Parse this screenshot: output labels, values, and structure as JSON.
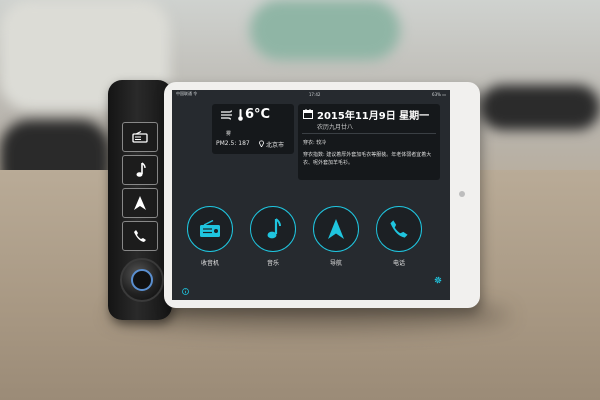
{
  "statusbar": {
    "carrier": "中国联通 令",
    "time": "17:42",
    "battery": "63% ▭"
  },
  "weather": {
    "temperature": "6°C",
    "condition": "雾",
    "pm25": "PM2.5: 187",
    "city": "北京市"
  },
  "calendar": {
    "date": "2015年11月9日  星期一",
    "lunar": "农历九月廿八",
    "dress": "穿衣: 较冷",
    "advice": "穿衣指数: 建议着厚外套加毛衣等服装。年老体弱者宜着大衣、呢外套加羊毛衫。"
  },
  "apps": [
    {
      "label": "收音机",
      "icon": "radio-icon"
    },
    {
      "label": "音乐",
      "icon": "music-note-icon"
    },
    {
      "label": "导航",
      "icon": "navigation-arrow-icon"
    },
    {
      "label": "电话",
      "icon": "phone-icon"
    }
  ],
  "dock_buttons": [
    "radio-icon",
    "music-note-icon",
    "navigation-arrow-icon",
    "phone-icon"
  ],
  "colors": {
    "accent": "#1fc5df",
    "screen_bg": "#262a2f",
    "card_bg": "#15181b"
  }
}
